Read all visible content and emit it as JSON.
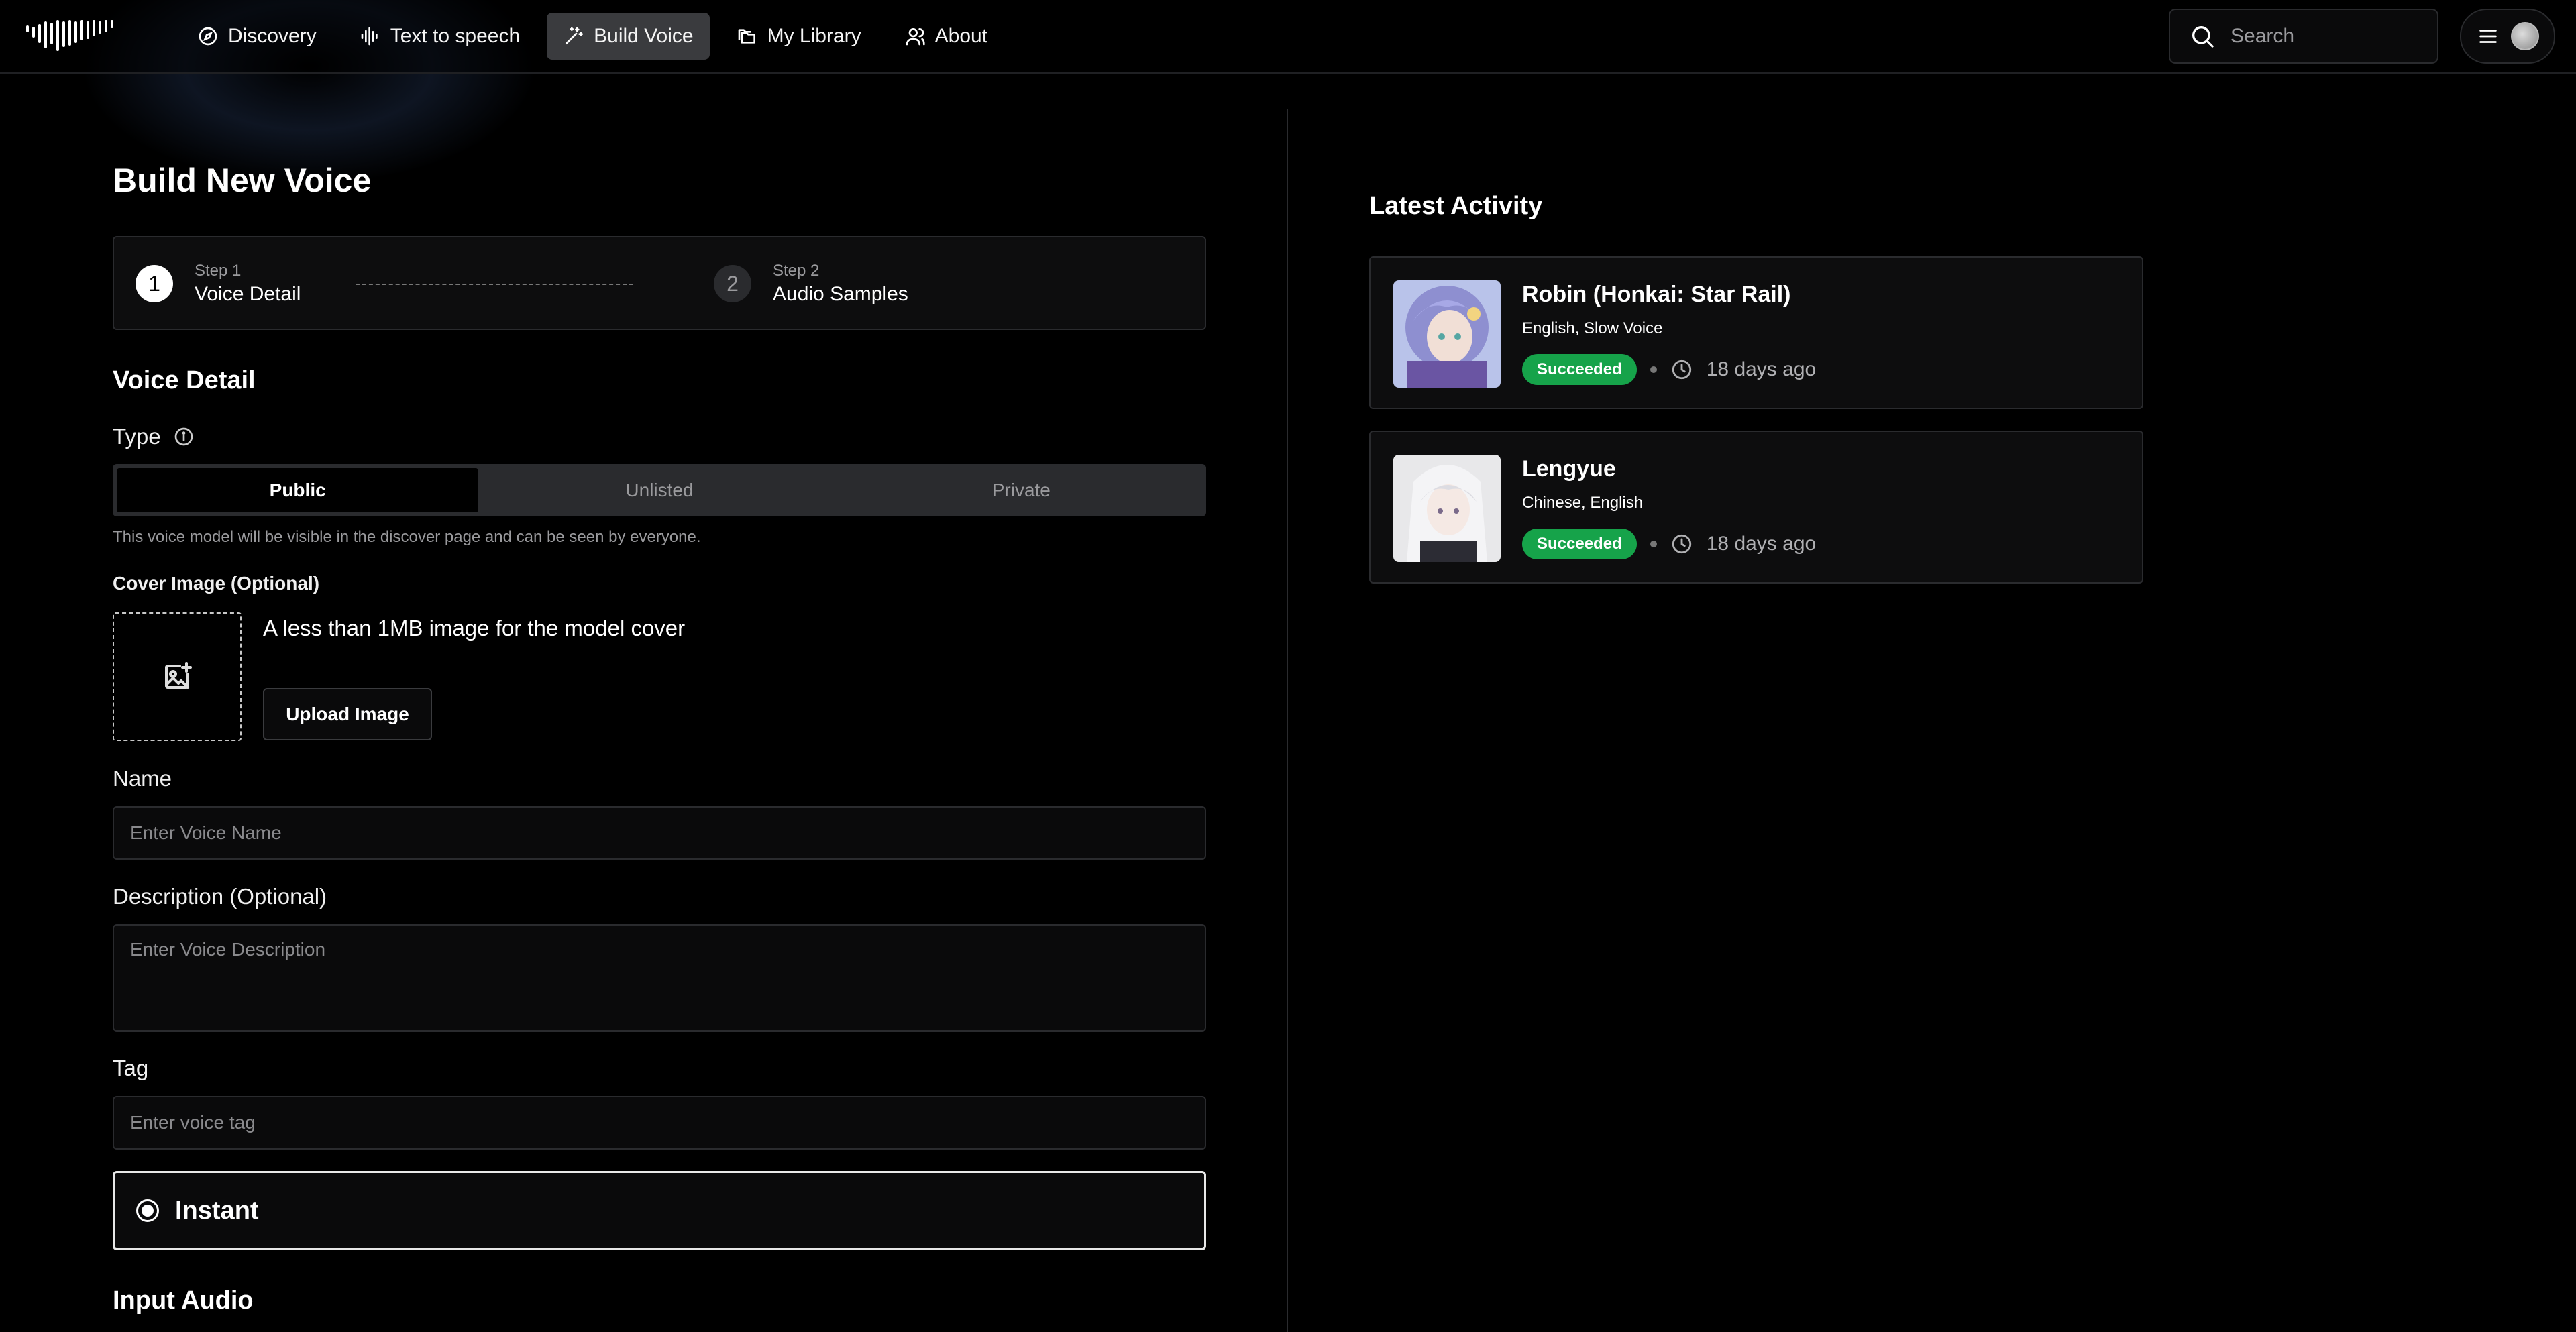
{
  "nav": {
    "items": [
      {
        "label": "Discovery",
        "icon": "compass-icon"
      },
      {
        "label": "Text to speech",
        "icon": "audio-waveform-icon"
      },
      {
        "label": "Build Voice",
        "icon": "magic-wand-icon",
        "active": true
      },
      {
        "label": "My Library",
        "icon": "folders-icon"
      },
      {
        "label": "About",
        "icon": "users-icon"
      }
    ],
    "search_placeholder": "Search"
  },
  "page": {
    "title": "Build New Voice"
  },
  "stepper": {
    "step1": {
      "number": "1",
      "small": "Step 1",
      "title": "Voice Detail"
    },
    "step2": {
      "number": "2",
      "small": "Step 2",
      "title": "Audio Samples"
    }
  },
  "voice_detail": {
    "heading": "Voice Detail",
    "type_label": "Type",
    "type_options": [
      "Public",
      "Unlisted",
      "Private"
    ],
    "type_selected": "Public",
    "type_hint": "This voice model will be visible in the discover page and can be seen by everyone.",
    "cover_label": "Cover Image (Optional)",
    "cover_text": "A less than 1MB image for the model cover",
    "upload_label": "Upload Image",
    "name_label": "Name",
    "name_placeholder": "Enter Voice Name",
    "description_label": "Description (Optional)",
    "description_placeholder": "Enter Voice Description",
    "tag_label": "Tag",
    "tag_placeholder": "Enter voice tag",
    "mode_label": "Instant",
    "input_audio_heading": "Input Audio"
  },
  "activity": {
    "title": "Latest Activity",
    "items": [
      {
        "name": "Robin (Honkai: Star Rail)",
        "languages": "English, Slow Voice",
        "status": "Succeeded",
        "time": "18 days ago"
      },
      {
        "name": "Lengyue",
        "languages": "Chinese, English",
        "status": "Succeeded",
        "time": "18 days ago"
      }
    ]
  },
  "colors": {
    "accent_success": "#16a34a",
    "background": "#000000",
    "panel": "#0d0d0e",
    "border": "#2a2b2e"
  }
}
